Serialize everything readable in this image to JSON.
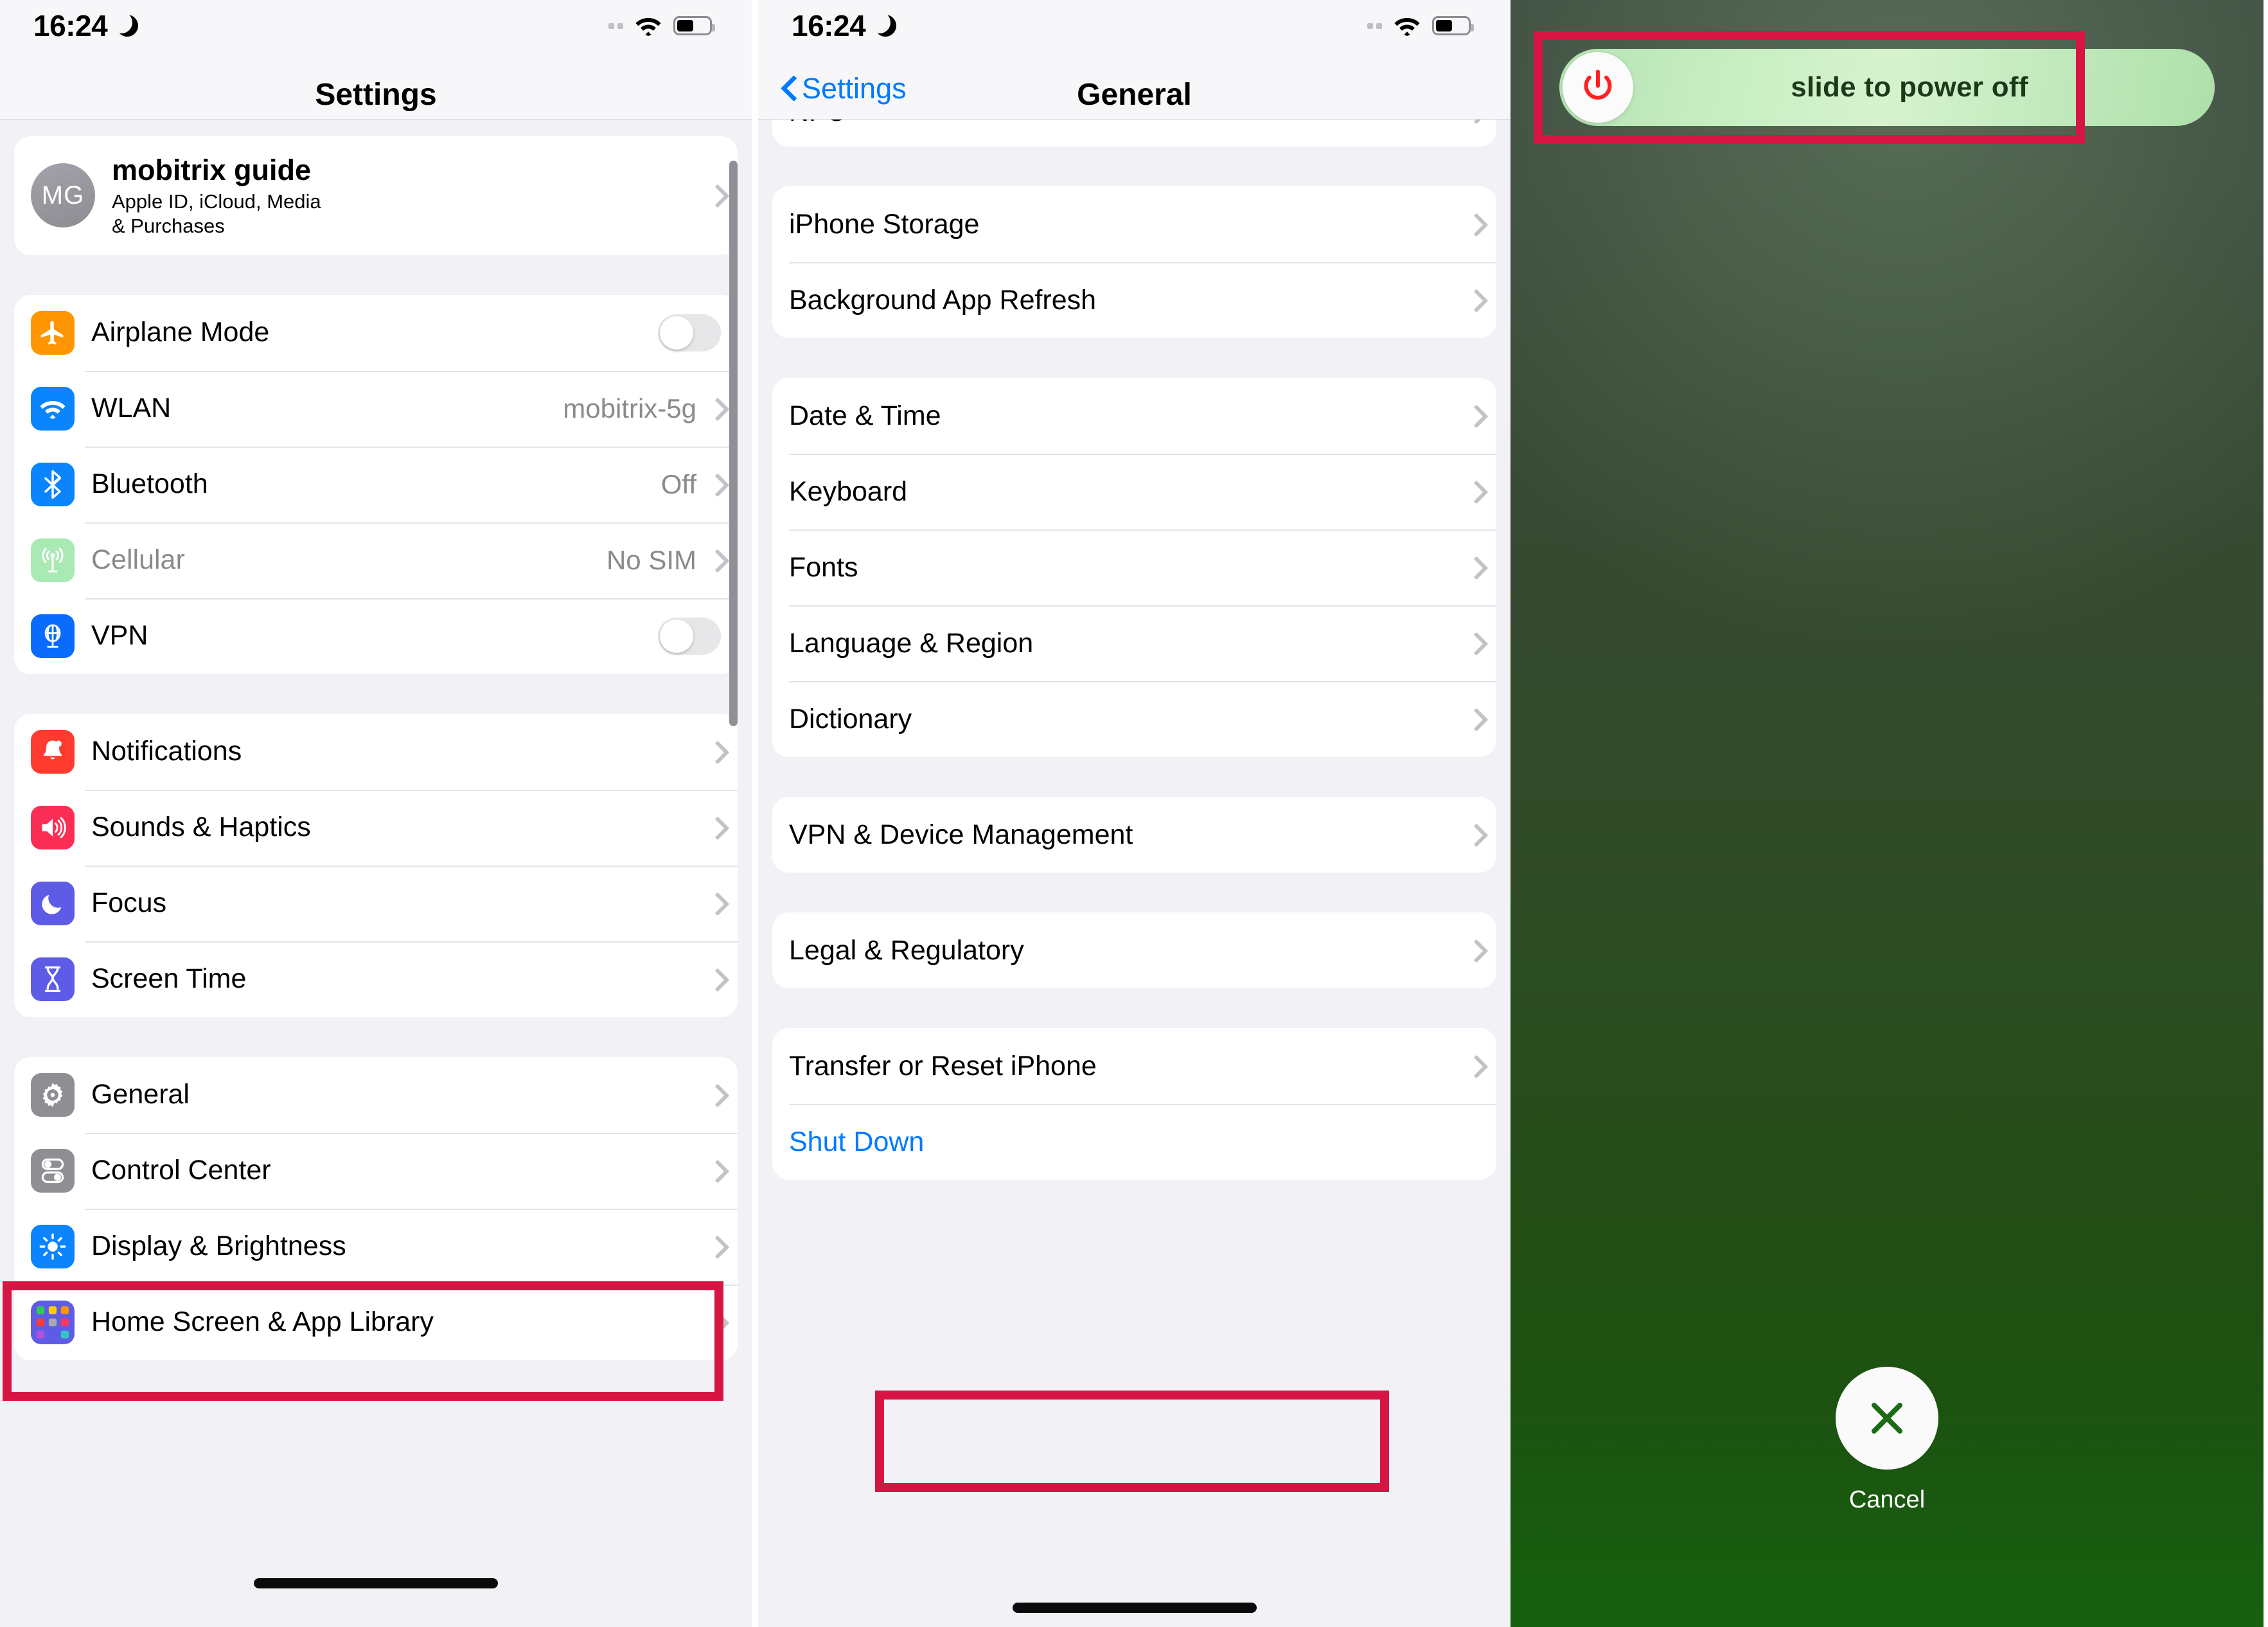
{
  "panel_settings": {
    "status_bar": {
      "time": "16:24",
      "moon_icon": "crescent-moon-icon",
      "wifi_icon": "wifi-icon",
      "battery_icon": "battery-icon",
      "signal_icon": "signal-dots-icon"
    },
    "nav": {
      "title": "Settings"
    },
    "account": {
      "initials": "MG",
      "name": "mobitrix guide",
      "subtitle": "Apple ID, iCloud, Media\n& Purchases"
    },
    "group_connectivity": [
      {
        "label": "Airplane Mode",
        "icon": "airplane-icon",
        "control": "toggle",
        "toggle_on": false
      },
      {
        "label": "WLAN",
        "icon": "wifi-icon",
        "control": "value",
        "value": "mobitrix-5g"
      },
      {
        "label": "Bluetooth",
        "icon": "bluetooth-icon",
        "control": "value",
        "value": "Off"
      },
      {
        "label": "Cellular",
        "icon": "cellular-icon",
        "control": "value",
        "value": "No SIM",
        "dim": true
      },
      {
        "label": "VPN",
        "icon": "vpn-globe-icon",
        "control": "toggle",
        "toggle_on": false
      }
    ],
    "group_alerts": [
      {
        "label": "Notifications",
        "icon": "bell-icon"
      },
      {
        "label": "Sounds & Haptics",
        "icon": "speaker-icon"
      },
      {
        "label": "Focus",
        "icon": "moon-icon"
      },
      {
        "label": "Screen Time",
        "icon": "hourglass-icon"
      }
    ],
    "group_system": [
      {
        "label": "General",
        "icon": "gear-icon"
      },
      {
        "label": "Control Center",
        "icon": "switches-icon"
      },
      {
        "label": "Display & Brightness",
        "icon": "brightness-icon"
      },
      {
        "label": "Home Screen & App Library",
        "icon": "app-grid-icon"
      }
    ],
    "highlight": "General"
  },
  "panel_general": {
    "status_bar": {
      "time": "16:24",
      "moon_icon": "crescent-moon-icon",
      "wifi_icon": "wifi-icon",
      "battery_icon": "battery-icon",
      "signal_icon": "signal-dots-icon"
    },
    "nav": {
      "back_label": "Settings",
      "title": "General",
      "back_icon": "chevron-left-icon"
    },
    "partial_top_row": {
      "label": "NFC"
    },
    "group_storage": [
      {
        "label": "iPhone Storage"
      },
      {
        "label": "Background App Refresh"
      }
    ],
    "group_locale": [
      {
        "label": "Date & Time"
      },
      {
        "label": "Keyboard"
      },
      {
        "label": "Fonts"
      },
      {
        "label": "Language & Region"
      },
      {
        "label": "Dictionary"
      }
    ],
    "group_vpn": [
      {
        "label": "VPN & Device Management"
      }
    ],
    "group_legal": [
      {
        "label": "Legal & Regulatory"
      }
    ],
    "group_reset": [
      {
        "label": "Transfer or Reset iPhone",
        "style": "normal"
      },
      {
        "label": "Shut Down",
        "style": "link"
      }
    ],
    "highlight": "Shut Down"
  },
  "panel_poweroff": {
    "slider": {
      "label": "slide to power off",
      "knob_icon": "power-icon"
    },
    "cancel": {
      "label": "Cancel",
      "icon": "close-x-icon"
    },
    "highlight": "slide to power off"
  },
  "colors": {
    "highlight_red": "#D71544",
    "ios_blue": "#007AFF",
    "panel_bg": "#F2F1F6",
    "card_bg": "#FFFFFF",
    "secondary_text": "#8A8A8E",
    "power_red": "#FF2020",
    "slider_green": "#C7EEC2"
  }
}
